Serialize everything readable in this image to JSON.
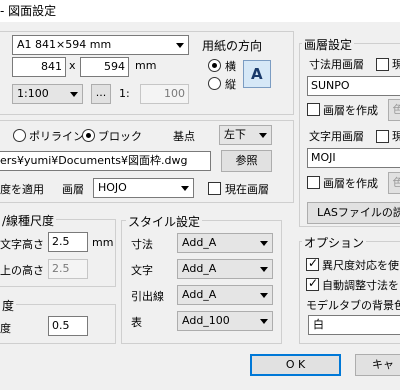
{
  "window": {
    "title": "- 図面設定"
  },
  "paper": {
    "size_selected": "A1  841×594 mm",
    "width": "841",
    "x_sep": "x",
    "height": "594",
    "unit": "mm",
    "scale_selected": "1:100",
    "dots_button": "...",
    "one_colon": "1:",
    "scale_value": "100"
  },
  "orientation": {
    "title": "用紙の方向",
    "landscape_label": "横",
    "portrait_label": "縦",
    "preview_letter": "A"
  },
  "frame": {
    "polyline_label": "ポリライン",
    "block_label": "ブロック",
    "basepoint_label": "基点",
    "basepoint_selected": "左下",
    "file_path": "ers¥yumi¥Documents¥図面枠.dwg",
    "browse_button": "参照",
    "apply_layer_label": "度を適用",
    "layer_label": "画層",
    "layer_selected": "HOJO",
    "current_layer_label": "現在画層"
  },
  "layer_settings": {
    "title": "画層設定",
    "dim_layer_label": "寸法用画層",
    "current_partial": "現",
    "dim_layer_value": "SUNPO",
    "create_layer_label": "画層を作成",
    "color_partial": "色",
    "text_layer_label": "文字用画層",
    "text_layer_value": "MOJI",
    "las_button": "LASファイルの読み"
  },
  "linetype": {
    "title": "/線種尺度",
    "text_height_label": "文字高さ",
    "text_height_value": "2.5",
    "text_height_unit": "mm",
    "upper_height_label": "上の高さ",
    "upper_height_value": "2.5"
  },
  "bottom_left": {
    "title": "度",
    "scale_label": "度",
    "scale_value": "0.5"
  },
  "style": {
    "title": "スタイル設定",
    "rows": [
      {
        "label": "寸法",
        "value": "Add_A"
      },
      {
        "label": "文字",
        "value": "Add_A"
      },
      {
        "label": "引出線",
        "value": "Add_A"
      },
      {
        "label": "表",
        "value": "Add_100"
      }
    ]
  },
  "options": {
    "title": "オプション",
    "opt1_label": "異尺度対応を使",
    "opt2_label": "自動調整寸法を",
    "model_bg_label": "モデルタブの背景色",
    "model_bg_value": "白"
  },
  "dialog": {
    "ok_button": "O K",
    "cancel_button": "キャ"
  }
}
